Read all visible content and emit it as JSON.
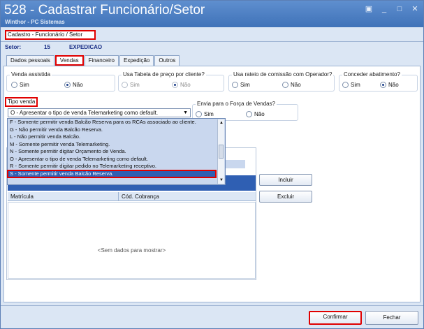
{
  "window": {
    "title": "528 - Cadastrar Funcionário/Setor",
    "subtitle": "Winthor - PC Sistemas",
    "controls": [
      "▣",
      "_",
      "□",
      "✕"
    ]
  },
  "breadcrumb": "Cadastro - Funcionário / Setor",
  "setor": {
    "label": "Setor:",
    "code": "15",
    "name": "EXPEDICAO"
  },
  "tabs": [
    {
      "label": "Dados pessoais"
    },
    {
      "label": "Vendas"
    },
    {
      "label": "Financeiro"
    },
    {
      "label": "Expedição"
    },
    {
      "label": "Outros"
    }
  ],
  "groups": {
    "venda_assistida": {
      "title": "Venda assistida",
      "sim": "Sim",
      "nao": "Não"
    },
    "tabela_preco": {
      "title": "Usa Tabela de preço por cliente?",
      "sim": "Sim",
      "nao": "Não"
    },
    "rateio": {
      "title": "Usa rateio de comissão com Operador?",
      "sim": "Sim",
      "nao": "Não"
    },
    "abatimento": {
      "title": "Conceder abatimento?",
      "sim": "Sim",
      "nao": "Não"
    },
    "forca_vendas": {
      "title": "Envia para o Força de Vendas?",
      "sim": "Sim",
      "nao": "Não"
    }
  },
  "tipo_venda": {
    "label": "Tipo venda",
    "selected": "O - Apresentar o tipo de venda Telemarketing como default.",
    "options": [
      "F - Somente permitir venda Balcão Reserva para os RCAs associado ao cliente.",
      "G - Não permitir venda Balcão Reserva.",
      "L - Não permitir venda Balcão.",
      "M - Somente permitir venda Telemarketing.",
      "N - Somente permitir digitar Orçamento de Venda.",
      "O - Apresentar o tipo de venda Telemarketing como default.",
      "R - Somente permitir digitar pedido no Telemarketing receptivo.",
      "S - Somente permitir venda Balcão Reserva."
    ]
  },
  "grid": {
    "col_matricula": "Matrícula",
    "col_cobranca": "Cód. Cobrança",
    "empty": "<Sem dados para mostrar>"
  },
  "buttons": {
    "incluir": "Incluir",
    "excluir": "Excluir",
    "confirmar": "Confirmar",
    "fechar": "Fechar"
  },
  "colors": {
    "title_bar": "#4a7cc0",
    "highlight": "#e00000",
    "selection": "#2f5fb3"
  }
}
